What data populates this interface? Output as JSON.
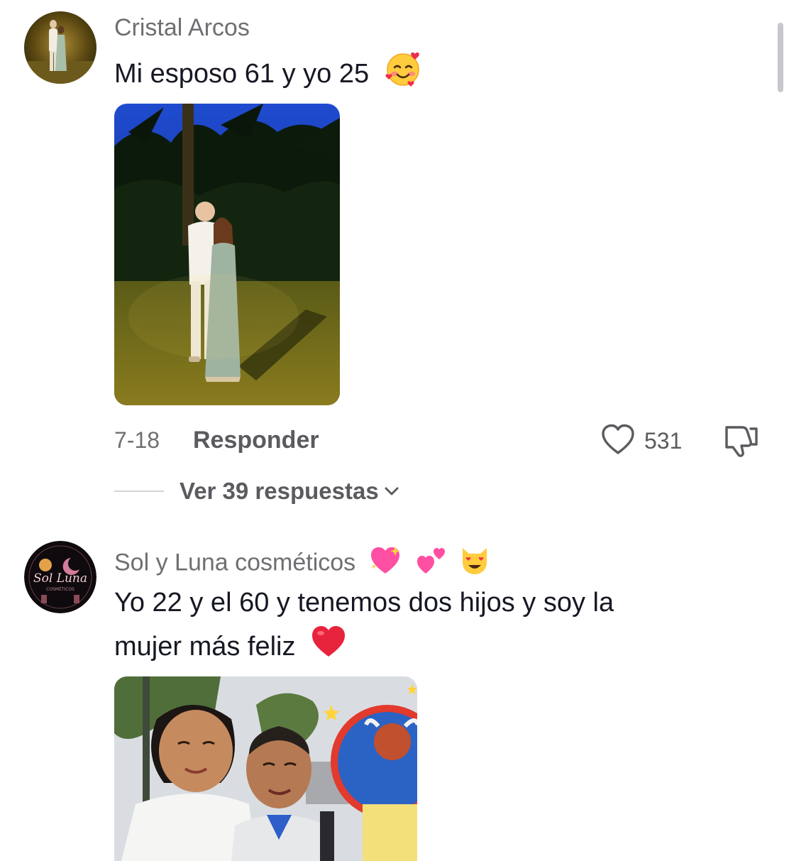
{
  "comments": [
    {
      "username": "Cristal Arcos",
      "text": "Mi esposo 61 y yo 25",
      "text_emoji": "smiling-face-with-hearts",
      "date": "7-18",
      "reply_label": "Responder",
      "likes": "531",
      "view_replies_label": "Ver 39 respuestas"
    },
    {
      "username": "Sol y Luna cosméticos",
      "username_emojis": [
        "sparkling-heart",
        "two-hearts",
        "smiling-cat-heart-eyes"
      ],
      "text_line1": "Yo 22 y el 60 y tenemos dos hijos y soy la",
      "text_line2": "mujer más feliz",
      "text_emoji": "red-heart",
      "avatar_logo_text": "Sol Luna",
      "avatar_logo_subtext": "COSMÉTICOS"
    }
  ],
  "colors": {
    "username": "#6f6f73",
    "text": "#161823",
    "secondary": "#5a5a5f",
    "divider": "#d5d5d8",
    "heart_emoji": "#e8243c",
    "pink_emoji": "#ff4fa3"
  }
}
